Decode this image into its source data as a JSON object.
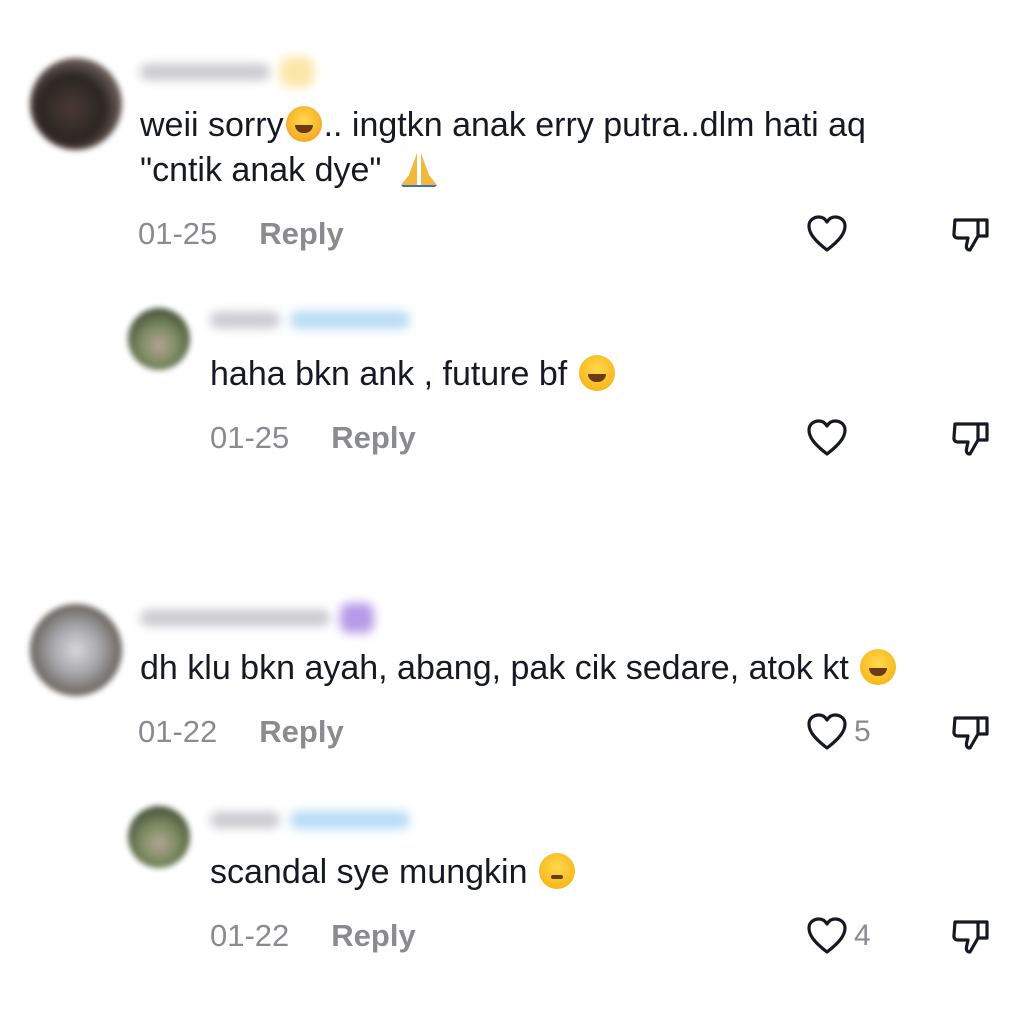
{
  "comments": [
    {
      "text_line1": "weii sorry",
      "text_line1b": ".. ingtkn anak erry putra..dlm hati aq",
      "text_line2": "\"cntik anak dye\"",
      "date": "01-25",
      "reply_label": "Reply",
      "like_count": "",
      "emoji": [
        "loudly-crying-face",
        "folded-hands"
      ]
    },
    {
      "text": "haha bkn ank , future bf",
      "date": "01-25",
      "reply_label": "Reply",
      "like_count": "",
      "emoji": [
        "face-with-tears-of-joy"
      ]
    },
    {
      "text": "dh klu bkn ayah, abang, pak cik sedare, atok kt",
      "date": "01-22",
      "reply_label": "Reply",
      "like_count": "5",
      "emoji": [
        "face-with-tears-of-joy"
      ]
    },
    {
      "text": "scandal sye mungkin",
      "date": "01-22",
      "reply_label": "Reply",
      "like_count": "4",
      "emoji": [
        "thinking-face"
      ]
    }
  ],
  "colors": {
    "text": "#161823",
    "meta": "#8a8b91",
    "creator_tag": "#b8dcf5",
    "emoji_tag": "#fbe7a8",
    "purple_tag": "#b69be8"
  },
  "icons": [
    "heart-icon",
    "thumbs-down-icon"
  ]
}
